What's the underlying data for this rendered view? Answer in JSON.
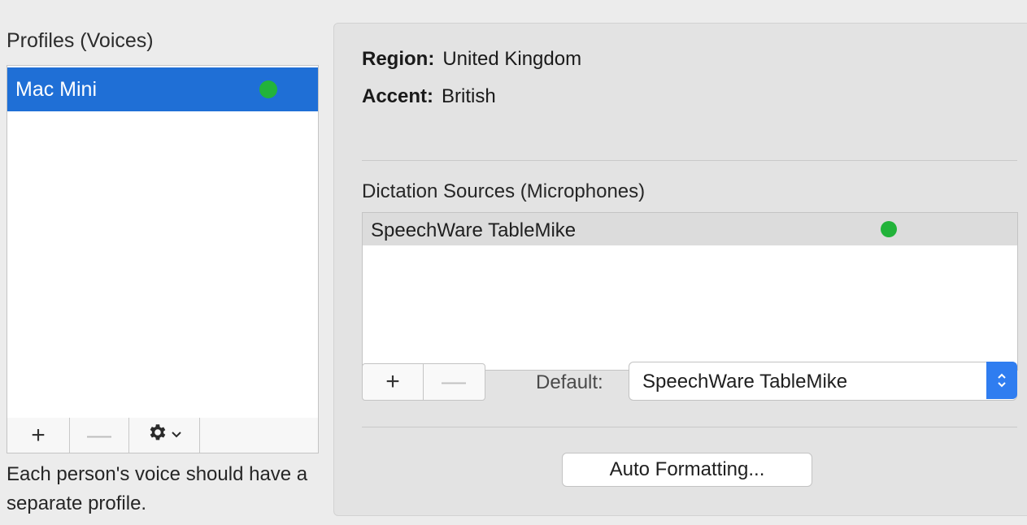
{
  "profiles": {
    "title": "Profiles (Voices)",
    "items": [
      {
        "name": "Mac Mini",
        "active": true
      }
    ],
    "toolbar": {
      "add": "+",
      "remove": "—"
    },
    "hint": "Each person's voice should have a separate profile."
  },
  "details": {
    "region_label": "Region:",
    "region_value": "United Kingdom",
    "accent_label": "Accent:",
    "accent_value": "British"
  },
  "sources": {
    "title": "Dictation Sources (Microphones)",
    "items": [
      {
        "name": "SpeechWare TableMike",
        "active": true
      }
    ],
    "add": "+",
    "remove": "—",
    "default_label": "Default:",
    "default_value": "SpeechWare TableMike"
  },
  "auto_formatting_label": "Auto Formatting...",
  "colors": {
    "selection": "#1f6fd6",
    "active_dot": "#22b33a",
    "stepper": "#2f7df0"
  },
  "icons": [
    "gear-icon",
    "chevron-down-icon",
    "up-down-chevron-icon"
  ]
}
